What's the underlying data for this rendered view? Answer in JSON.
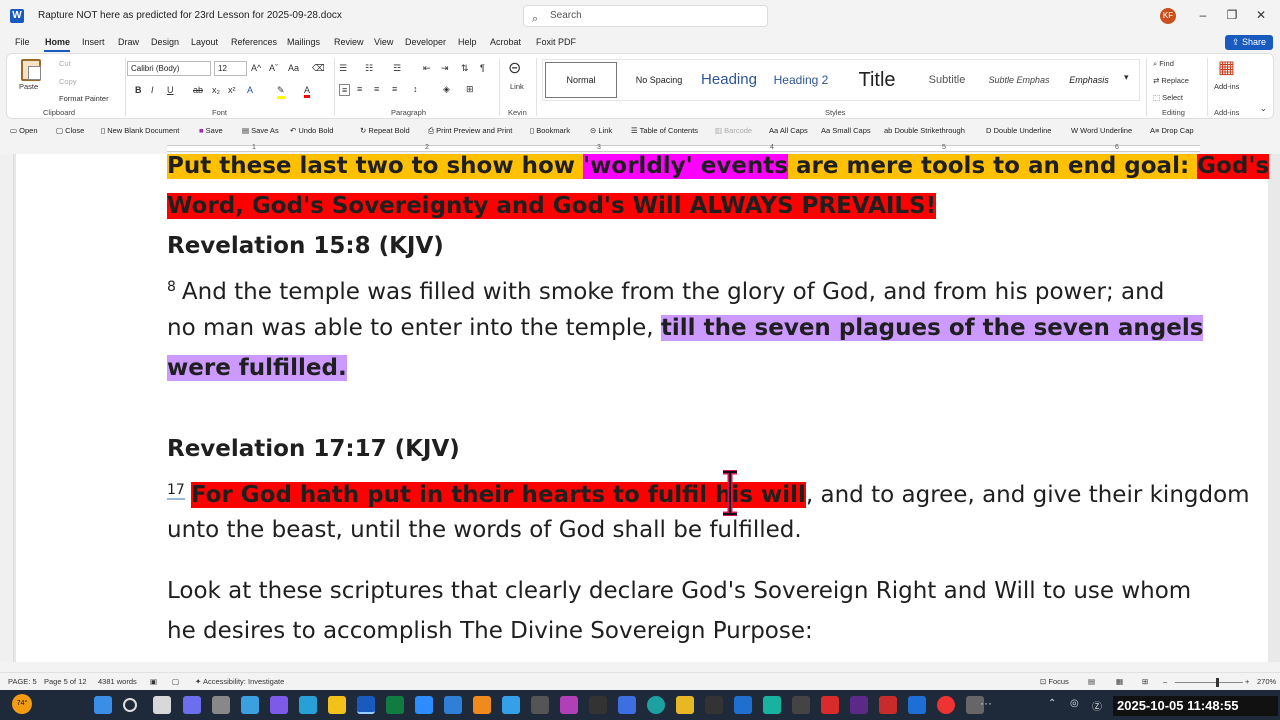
{
  "window": {
    "doc_title": "Rapture NOT here as predicted for 23rd Lesson for 2025-09-28.docx",
    "search_placeholder": "Search",
    "avatar_initials": "KF"
  },
  "menu": {
    "items": [
      "File",
      "Home",
      "Insert",
      "Draw",
      "Design",
      "Layout",
      "References",
      "Mailings",
      "Review",
      "View",
      "Developer",
      "Help",
      "Acrobat",
      "Foxit PDF"
    ],
    "share": "Share"
  },
  "ribbon": {
    "clipboard": {
      "paste": "Paste",
      "cut": "Cut",
      "copy": "Copy",
      "format_painter": "Format Painter",
      "label": "Clipboard"
    },
    "font": {
      "family": "Calibri (Body)",
      "size": "12",
      "label": "Font"
    },
    "paragraph": {
      "label": "Paragraph"
    },
    "kevin": {
      "link": "Link",
      "label": "Kevin"
    },
    "styles": {
      "label": "Styles",
      "normal": "Normal",
      "no_spacing": "No Spacing",
      "heading1": "Heading",
      "heading2": "Heading 2",
      "title": "Title",
      "subtitle": "Subtitle",
      "subtle_emphasis": "Subtle Emphas",
      "emphasis": "Emphasis"
    },
    "editing": {
      "find": "Find",
      "replace": "Replace",
      "select": "Select",
      "label": "Editing"
    },
    "addins": {
      "addins": "Add-ins",
      "label": "Add-ins"
    }
  },
  "qat": {
    "open": "Open",
    "close": "Close",
    "new_blank": "New Blank Document",
    "save": "Save",
    "save_as": "Save As",
    "undo_bold": "Undo Bold",
    "repeat_bold": "Repeat Bold",
    "print_preview": "Print Preview and Print",
    "bookmark": "Bookmark",
    "link": "Link",
    "toc": "Table of Contents",
    "barcode": "Barcode",
    "all_caps": "All Caps",
    "small_caps": "Small Caps",
    "double_strike": "Double Strikethrough",
    "double_underline": "Double Underline",
    "word_underline": "Word Underline",
    "drop_cap": "Drop Cap"
  },
  "ruler": {
    "marks": [
      "1",
      "2",
      "3",
      "4",
      "5",
      "6"
    ]
  },
  "document": {
    "l1_a": "Put these last two to show how ",
    "l1_b": "'worldly' events",
    "l1_c": " are mere tools to an end goal: ",
    "l1_d": "God's",
    "l2": "Word, God's Sovereignty and God's Will ALWAYS PREVAILS!",
    "h1": "Revelation 15:8 (KJV)",
    "v8_num": "8",
    "v8_a": "And the temple was filled with smoke from the glory of God, and from his power; and",
    "v8_b": "no man was able to enter into the temple, ",
    "v8_c": "till the seven plagues of the seven angels",
    "v8_d": "were fulfilled.",
    "h2": "Revelation 17:17 (KJV)",
    "v17_num": "17",
    "v17_a": "For God hath put in their hearts to fulfil his will",
    "v17_b": ", and to agree, and give their kingdom",
    "v17_c": "unto the beast, until the words of God shall be fulfilled.",
    "p1": "Look at these scriptures that clearly declare God's Sovereign Right and Will to use whom",
    "p2": "he desires to accomplish The Divine Sovereign Purpose:"
  },
  "status": {
    "page": "PAGE: 5",
    "page_of": "Page 5 of 12",
    "words": "4381 words",
    "accessibility": "Accessibility: Investigate",
    "focus": "Focus",
    "zoom": "270%"
  },
  "taskbar": {
    "temp": "74°",
    "clock": "2025-10-05 11:48:55"
  },
  "colors": {
    "accent": "#185abd",
    "highlight_yellow": "#ffc000",
    "highlight_magenta": "#ff00ff",
    "highlight_red": "#ff0000",
    "highlight_purple": "#cc99ff"
  }
}
